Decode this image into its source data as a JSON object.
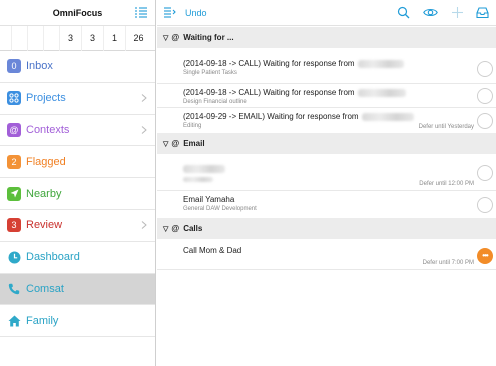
{
  "sidebar": {
    "title": "OmniFocus",
    "forecast": [
      "3",
      "3",
      "1",
      "26"
    ],
    "items": [
      {
        "label": "Inbox",
        "badge": "0",
        "color": "#6a87d8",
        "text_color": "#4a73c8",
        "has_chevron": false
      },
      {
        "label": "Projects",
        "badge": "",
        "color": "#3c8fe0",
        "text_color": "#3c8fe0",
        "has_chevron": true
      },
      {
        "label": "Contexts",
        "badge": "@",
        "color": "#a25fd8",
        "text_color": "#a25fd8",
        "has_chevron": true
      },
      {
        "label": "Flagged",
        "badge": "2",
        "color": "#f39237",
        "text_color": "#f07f22",
        "has_chevron": false
      },
      {
        "label": "Nearby",
        "badge": "",
        "color": "#5cbf3c",
        "text_color": "#3fa63b",
        "has_chevron": false
      },
      {
        "label": "Review",
        "badge": "3",
        "color": "#d64034",
        "text_color": "#c9302c",
        "has_chevron": true
      },
      {
        "label": "Dashboard",
        "badge": "",
        "color": "#2fa9c9",
        "text_color": "#2aa3c5",
        "has_chevron": false
      },
      {
        "label": "Comsat",
        "badge": "",
        "color": "#2fa9c9",
        "text_color": "#2aa3c5",
        "has_chevron": false,
        "selected": true
      },
      {
        "label": "Family",
        "badge": "",
        "color": "#2fa9c9",
        "text_color": "#2aa3c5",
        "has_chevron": false
      }
    ]
  },
  "toolbar": {
    "undo_label": "Undo",
    "accent": "#1e9bd7"
  },
  "sections": [
    {
      "title": "Waiting for ...",
      "rows": [
        {
          "title": "(2014-09-18  ->  CALL)  Waiting for response from",
          "sub": "Single Patient Tasks",
          "defer": ""
        },
        {
          "title": "(2014-09-18  ->  CALL)  Waiting for response from",
          "sub": "Design Financial outline",
          "defer": ""
        },
        {
          "title": "(2014-09-29 -> EMAIL)  Waiting for response from",
          "sub": "Editing",
          "defer": "Defer until Yesterday"
        }
      ]
    },
    {
      "title": "Email",
      "rows": [
        {
          "title": "",
          "sub": "",
          "defer": "Defer until 12:00 PM"
        },
        {
          "title": "Email Yamaha",
          "sub": "General DAW Development",
          "defer": ""
        }
      ]
    },
    {
      "title": "Calls",
      "rows": [
        {
          "title": "Call Mom & Dad",
          "sub": "",
          "defer": "Defer until 7:00 PM",
          "flagged": true
        }
      ]
    }
  ]
}
